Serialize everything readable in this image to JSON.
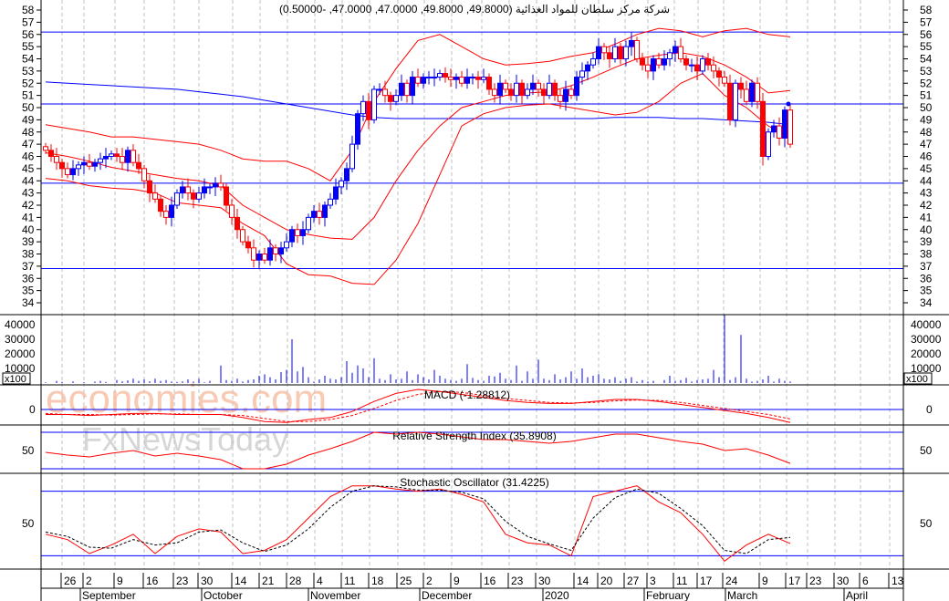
{
  "title": "شركة مركز سلطان للمواد الغذائية (49.8000, 49.8000, 47.0000, 47.0000, -0.50000)",
  "watermark": {
    "line1": "economies.com",
    "line2": "FxNewsToday"
  },
  "colors": {
    "up": "#0000ff",
    "down": "#ff0000",
    "grid": "#c0c0c0",
    "line": "#0000ff",
    "band": "#ff0000"
  },
  "chart_data": [
    {
      "type": "candlestick",
      "name": "price",
      "ylim": [
        34,
        58
      ],
      "yticks": [
        34,
        35,
        36,
        37,
        38,
        39,
        40,
        41,
        42,
        43,
        44,
        45,
        46,
        47,
        48,
        49,
        50,
        51,
        52,
        53,
        54,
        55,
        56,
        57,
        58
      ],
      "hlines": [
        56.2,
        50.3,
        43.8,
        36.8
      ],
      "close": [
        46.5,
        46,
        45.5,
        45,
        44.5,
        45,
        45.3,
        45.5,
        45.2,
        45.5,
        45.8,
        46,
        46.2,
        46,
        45.5,
        46.5,
        45.5,
        45,
        44,
        43,
        42.5,
        41.5,
        41,
        42,
        43,
        43.5,
        43,
        42.5,
        43,
        43.5,
        43.5,
        43.8,
        43.5,
        42,
        41,
        40,
        39,
        38.5,
        37.5,
        38,
        37.5,
        38.5,
        38,
        38.5,
        39,
        40,
        39.5,
        40,
        41,
        41.5,
        41,
        42,
        42.5,
        43.5,
        44,
        45,
        47,
        49.5,
        50.5,
        49,
        51.5,
        51.5,
        51,
        50.5,
        51,
        52,
        51,
        52.5,
        52,
        52.5,
        52.5,
        52.5,
        52.8,
        52.5,
        52.3,
        52.5,
        52,
        52.5,
        52.5,
        52.3,
        52.5,
        51.5,
        51,
        52,
        51.5,
        51,
        52,
        51,
        51.5,
        52,
        51.5,
        51,
        52,
        51,
        50.5,
        51.5,
        51,
        52.5,
        53,
        53.5,
        54,
        55,
        54.5,
        54,
        55,
        54,
        55,
        55.5,
        54,
        53.5,
        53,
        54,
        53.5,
        54,
        54.5,
        55,
        54,
        53.5,
        53.5,
        53,
        54,
        53.5,
        53,
        52.5,
        52,
        49,
        52,
        51.5,
        50.5,
        52,
        50.5,
        46,
        48,
        48.5,
        47.5,
        49.8,
        47
      ],
      "indicator_step": 4,
      "bollinger_upper": [
        48.6,
        48.3,
        48.0,
        47.6,
        47.6,
        47.4,
        47.2,
        47.0,
        46.5,
        45.8,
        45.6,
        45.6,
        45.0,
        44.0,
        46.5,
        50.5,
        53.2,
        55.5,
        56.0,
        55.0,
        54.0,
        53.5,
        53.6,
        53.8,
        54.2,
        54.5,
        55.2,
        56.0,
        56.5,
        56.3,
        55.8,
        56.3,
        56.5,
        56.0,
        55.8
      ],
      "bollinger_mid": [
        46.3,
        46.0,
        45.6,
        45.1,
        44.8,
        44.5,
        44.2,
        44.0,
        43.6,
        42.0,
        41.0,
        40.0,
        39.6,
        39.3,
        39.2,
        41.0,
        44.0,
        46.5,
        48.5,
        50.0,
        50.5,
        51.0,
        51.2,
        51.3,
        51.8,
        52.5,
        53.3,
        54.0,
        54.3,
        54.5,
        54.2,
        53.5,
        52.5,
        51.2,
        51.4
      ],
      "bollinger_lower": [
        44.2,
        44.0,
        43.6,
        43.4,
        43.3,
        43.0,
        42.2,
        42.0,
        41.8,
        40.5,
        39.5,
        37.2,
        36.3,
        36.2,
        35.6,
        35.5,
        37.5,
        40.5,
        44.5,
        48.5,
        49.5,
        50.0,
        50.2,
        50.3,
        50.0,
        49.7,
        49.4,
        49.6,
        50.5,
        52.0,
        52.8,
        51.0,
        50.0,
        48.5,
        47.5
      ],
      "moving_average": [
        52.1,
        52.0,
        51.9,
        51.8,
        51.7,
        51.6,
        51.5,
        51.3,
        51.1,
        50.9,
        50.6,
        50.3,
        50.0,
        49.7,
        49.4,
        49.2,
        49.1,
        49.1,
        49.1,
        49.1,
        49.1,
        49.1,
        49.1,
        49.1,
        49.1,
        49.1,
        49.2,
        49.2,
        49.2,
        49.1,
        49.1,
        49.0,
        48.9,
        48.8,
        48.6
      ]
    },
    {
      "type": "bar",
      "name": "volume",
      "unit_label": "x100",
      "yticks": [
        10000,
        20000,
        30000,
        40000
      ],
      "ylim": [
        0,
        40000
      ],
      "values": [
        500,
        0,
        1500,
        800,
        0,
        1200,
        0,
        600,
        0,
        1000,
        1500,
        800,
        0,
        2000,
        1200,
        1800,
        3000,
        1500,
        2500,
        1200,
        3000,
        1500,
        2000,
        1000,
        800,
        1200,
        2500,
        1000,
        3000,
        500,
        1500,
        0,
        12000,
        2000,
        1500,
        3000,
        1000,
        2000,
        2500,
        5000,
        6000,
        4000,
        2500,
        7500,
        9000,
        30000,
        8000,
        11000,
        4000,
        1000,
        2500,
        5000,
        3000,
        2500,
        4000,
        15000,
        7000,
        12000,
        10000,
        4000,
        17000,
        3000,
        2000,
        6000,
        2500,
        3000,
        8000,
        2000,
        6000,
        4000,
        2500,
        9000,
        5000,
        3000,
        2000,
        1500,
        3000,
        13000,
        3500,
        2000,
        1500,
        5000,
        4500,
        7000,
        3000,
        2000,
        12000,
        1500,
        8000,
        3000,
        16000,
        3000,
        2000,
        6000,
        2500,
        4000,
        8000,
        3000,
        10000,
        4000,
        5000,
        6000,
        3000,
        2500,
        4000,
        1500,
        3000,
        4000,
        1000,
        2000,
        1000,
        1500,
        0,
        2000,
        5000,
        1500,
        2000,
        3500,
        1000,
        2000,
        2500,
        3000,
        9000,
        4000,
        47000,
        2000,
        4000,
        33000,
        3000,
        1000,
        1500,
        2500,
        5000,
        1000,
        3000,
        1500,
        1000
      ]
    },
    {
      "type": "line",
      "name": "macd",
      "label": "MACD (-1.28812)",
      "ytick": "0",
      "ylim": [
        -2,
        2.5
      ],
      "macd": [
        -0.5,
        -0.5,
        -0.6,
        -0.5,
        -0.4,
        -0.4,
        -0.5,
        -0.5,
        -0.5,
        -0.8,
        -1.2,
        -1.3,
        -1.0,
        -0.8,
        -0.2,
        0.8,
        1.6,
        2.0,
        1.8,
        1.5,
        1.2,
        0.9,
        0.7,
        0.6,
        0.6,
        0.8,
        1.0,
        1.0,
        0.8,
        0.5,
        0.2,
        -0.1,
        -0.4,
        -0.8,
        -1.29
      ],
      "signal": [
        -0.4,
        -0.5,
        -0.5,
        -0.55,
        -0.5,
        -0.45,
        -0.45,
        -0.5,
        -0.5,
        -0.6,
        -0.9,
        -1.2,
        -1.2,
        -1.0,
        -0.6,
        0.1,
        0.9,
        1.5,
        1.8,
        1.7,
        1.4,
        1.1,
        0.9,
        0.7,
        0.65,
        0.7,
        0.85,
        0.95,
        0.9,
        0.7,
        0.4,
        0.1,
        -0.2,
        -0.5,
        -0.95
      ]
    },
    {
      "type": "line",
      "name": "rsi",
      "label": "Relative Strength Index (35.8908)",
      "ytick": "50",
      "levels": [
        70,
        30
      ],
      "ylim": [
        25,
        78
      ],
      "values": [
        48,
        45,
        43,
        47,
        50,
        44,
        47,
        44,
        40,
        30,
        30,
        35,
        45,
        52,
        60,
        70,
        68,
        70,
        68,
        65,
        62,
        62,
        60,
        58,
        60,
        64,
        68,
        68,
        64,
        60,
        57,
        50,
        52,
        45,
        35.9
      ]
    },
    {
      "type": "line",
      "name": "stochastic",
      "label": "Stochastic Oscillator (31.4225)",
      "ytick": "50",
      "levels": [
        80,
        20
      ],
      "ylim": [
        5,
        95
      ],
      "k": [
        40,
        35,
        22,
        30,
        40,
        22,
        38,
        45,
        42,
        22,
        25,
        35,
        55,
        75,
        85,
        85,
        82,
        80,
        82,
        77,
        70,
        40,
        32,
        30,
        20,
        75,
        80,
        85,
        70,
        60,
        40,
        15,
        30,
        40,
        31.4
      ],
      "d": [
        42,
        38,
        28,
        27,
        35,
        30,
        32,
        42,
        44,
        32,
        24,
        30,
        45,
        65,
        80,
        85,
        84,
        81,
        81,
        79,
        73,
        52,
        38,
        31,
        25,
        55,
        74,
        82,
        78,
        64,
        48,
        25,
        22,
        35,
        37
      ]
    }
  ],
  "x_axis": {
    "days": [
      "26",
      "2",
      "9",
      "16",
      "23",
      "30",
      "14",
      "21",
      "28",
      "4",
      "11",
      "18",
      "25",
      "2",
      "9",
      "16",
      "23",
      "30",
      "14",
      "20",
      "27",
      "3",
      "11",
      "17",
      "24",
      "9",
      "17",
      "23",
      "30",
      "6",
      "13"
    ],
    "months": [
      "September",
      "October",
      "November",
      "December",
      "2020",
      "February",
      "March",
      "April"
    ]
  }
}
